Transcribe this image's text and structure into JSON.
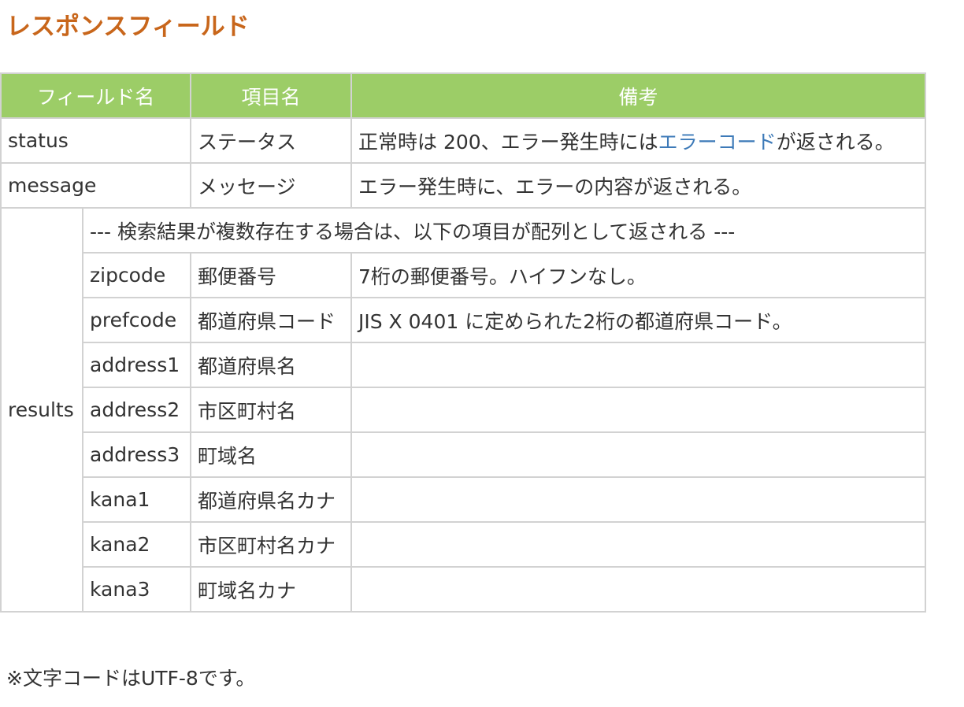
{
  "title": "レスポンスフィールド",
  "table": {
    "headers": {
      "field": "フィールド名",
      "item": "項目名",
      "remarks": "備考"
    },
    "status": {
      "field": "status",
      "item": "ステータス",
      "remarks_prefix": "正常時は 200、エラー発生時には",
      "remarks_link": "エラーコード",
      "remarks_suffix": "が返される。"
    },
    "message": {
      "field": "message",
      "item": "メッセージ",
      "remarks": "エラー発生時に、エラーの内容が返される。"
    },
    "results": {
      "field": "results",
      "caption": "--- 検索結果が複数存在する場合は、以下の項目が配列として返される ---",
      "rows": [
        {
          "field": "zipcode",
          "item": "郵便番号",
          "remarks": "7桁の郵便番号。ハイフンなし。"
        },
        {
          "field": "prefcode",
          "item": "都道府県コード",
          "remarks": "JIS X 0401 に定められた2桁の都道府県コード。"
        },
        {
          "field": "address1",
          "item": "都道府県名",
          "remarks": ""
        },
        {
          "field": "address2",
          "item": "市区町村名",
          "remarks": ""
        },
        {
          "field": "address3",
          "item": "町域名",
          "remarks": ""
        },
        {
          "field": "kana1",
          "item": "都道府県名カナ",
          "remarks": ""
        },
        {
          "field": "kana2",
          "item": "市区町村名カナ",
          "remarks": ""
        },
        {
          "field": "kana3",
          "item": "町域名カナ",
          "remarks": ""
        }
      ]
    }
  },
  "note": "※文字コードはUTF-8です。",
  "colors": {
    "title": "#c8661b",
    "header_bg": "#9ccd67",
    "link": "#3d7ab8",
    "border": "#d2d2d2"
  }
}
